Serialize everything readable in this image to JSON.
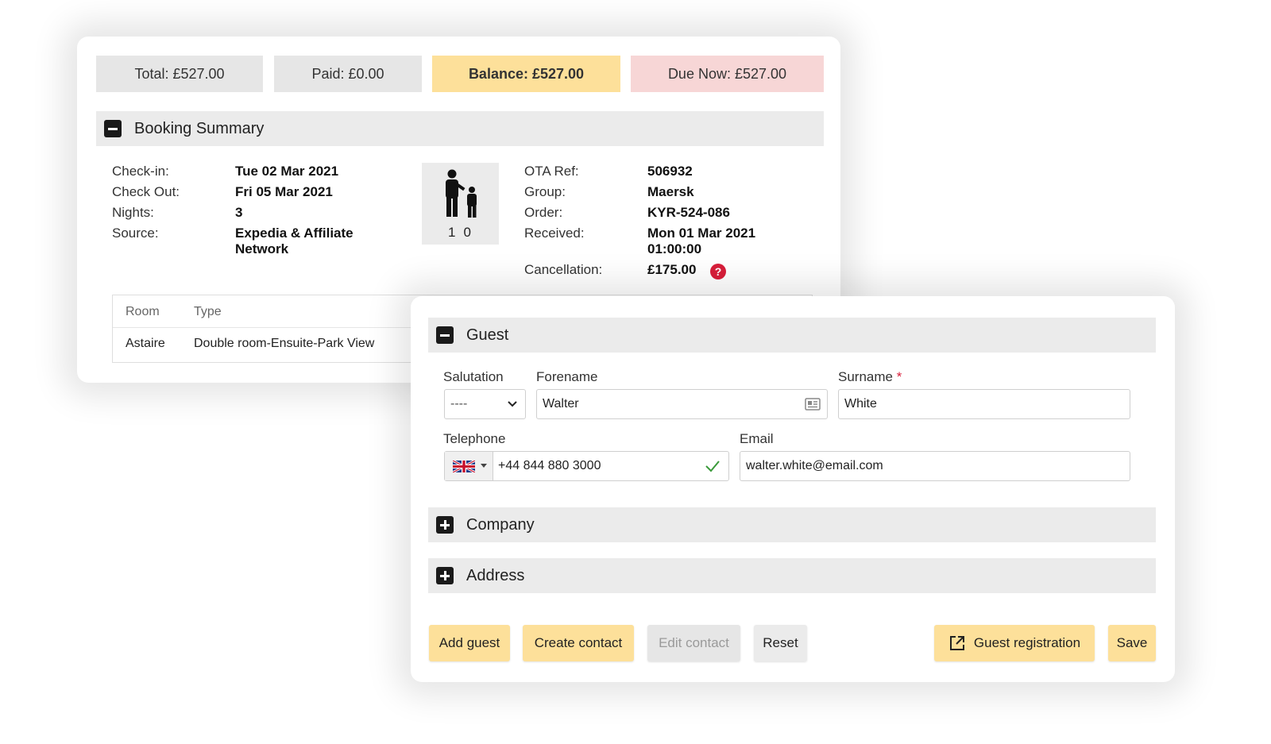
{
  "totals": {
    "total": "Total: £527.00",
    "paid": "Paid: £0.00",
    "balance": "Balance: £527.00",
    "due_now": "Due Now: £527.00"
  },
  "booking_summary": {
    "title": "Booking Summary",
    "left": [
      {
        "label": "Check-in:",
        "value": "Tue 02 Mar 2021"
      },
      {
        "label": "Check Out:",
        "value": "Fri 05 Mar 2021"
      },
      {
        "label": "Nights:",
        "value": "3"
      },
      {
        "label": "Source:",
        "value_line1": "Expedia & Affiliate",
        "value_line2": "Network"
      }
    ],
    "occupancy": {
      "adults": "1",
      "children": "0"
    },
    "right": [
      {
        "label": "OTA Ref:",
        "value": "506932"
      },
      {
        "label": "Group:",
        "value": "Maersk"
      },
      {
        "label": "Order:",
        "value": "KYR-524-086"
      },
      {
        "label": "Received:",
        "value_line1": "Mon 01 Mar 2021",
        "value_line2": "01:00:00"
      },
      {
        "label": "Cancellation:",
        "value": "£175.00"
      }
    ],
    "help_icon": "?",
    "room_table": {
      "headers": [
        "Room",
        "Type"
      ],
      "rows": [
        [
          "Astaire",
          "Double room-Ensuite-Park View"
        ]
      ]
    }
  },
  "guest": {
    "title": "Guest",
    "salutation_label": "Salutation",
    "salutation_value": "----",
    "forename_label": "Forename",
    "forename_value": "Walter",
    "surname_label": "Surname",
    "surname_required": "*",
    "surname_value": "White",
    "telephone_label": "Telephone",
    "telephone_value": "+44 844 880 3000",
    "email_label": "Email",
    "email_value": "walter.white@email.com"
  },
  "sections": {
    "company": "Company",
    "address": "Address"
  },
  "buttons": {
    "add_guest": "Add guest",
    "create_contact": "Create contact",
    "edit_contact": "Edit contact",
    "reset": "Reset",
    "guest_registration": "Guest registration",
    "save": "Save"
  },
  "colors": {
    "accent_yellow": "#fde09a",
    "due_pink": "#f7d6d6",
    "required_red": "#d81e3a",
    "success_green": "#3a9a3a"
  }
}
